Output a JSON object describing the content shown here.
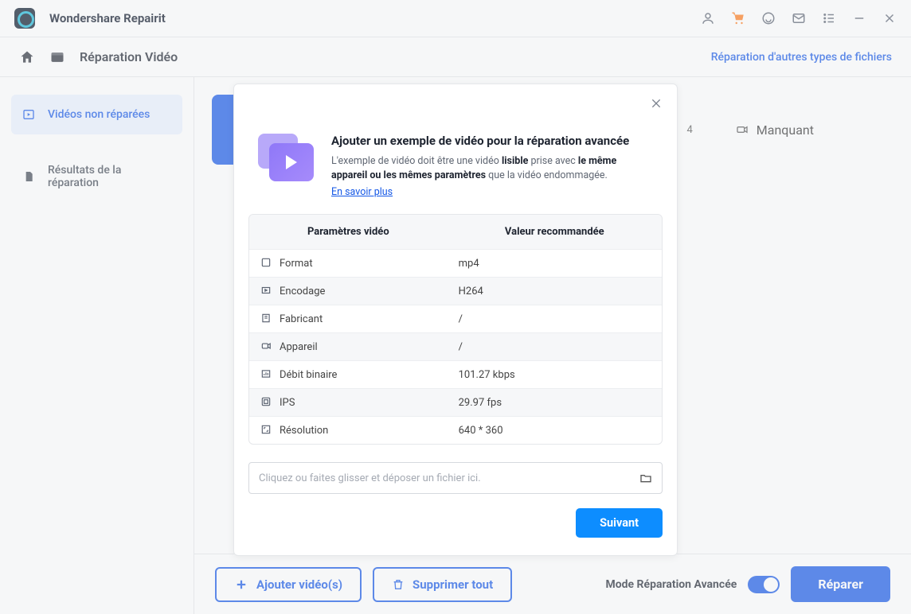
{
  "app": {
    "title": "Wondershare Repairit"
  },
  "breadcrumb": {
    "title": "Réparation Vidéo",
    "other_link": "Réparation d'autres types de fichiers"
  },
  "sidebar": {
    "items": [
      {
        "label": "Vidéos non réparées"
      },
      {
        "label": "Résultats de la réparation"
      }
    ]
  },
  "content": {
    "file_status": "Manquant",
    "file_codec_short": "4"
  },
  "footer": {
    "add": "Ajouter vidéo(s)",
    "delete_all": "Supprimer tout",
    "mode_label": "Mode Réparation Avancée",
    "repair": "Réparer"
  },
  "modal": {
    "title": "Ajouter un exemple de vidéo pour la réparation avancée",
    "desc_pre": "L'exemple de vidéo doit être une vidéo ",
    "desc_b1": "lisible",
    "desc_mid": " prise avec ",
    "desc_b2": "le même appareil ou les mêmes paramètres",
    "desc_post": " que la vidéo endommagée.",
    "learn_more": "En savoir plus",
    "col_param": "Paramètres vidéo",
    "col_value": "Valeur recommandée",
    "rows": [
      {
        "label": "Format",
        "value": "mp4"
      },
      {
        "label": "Encodage",
        "value": "H264"
      },
      {
        "label": "Fabricant",
        "value": "/"
      },
      {
        "label": "Appareil",
        "value": "/"
      },
      {
        "label": "Débit binaire",
        "value": "101.27 kbps"
      },
      {
        "label": "IPS",
        "value": "29.97 fps"
      },
      {
        "label": "Résolution",
        "value": "640 * 360"
      }
    ],
    "dropzone_placeholder": "Cliquez ou faites glisser et déposer un fichier ici.",
    "next": "Suivant"
  }
}
